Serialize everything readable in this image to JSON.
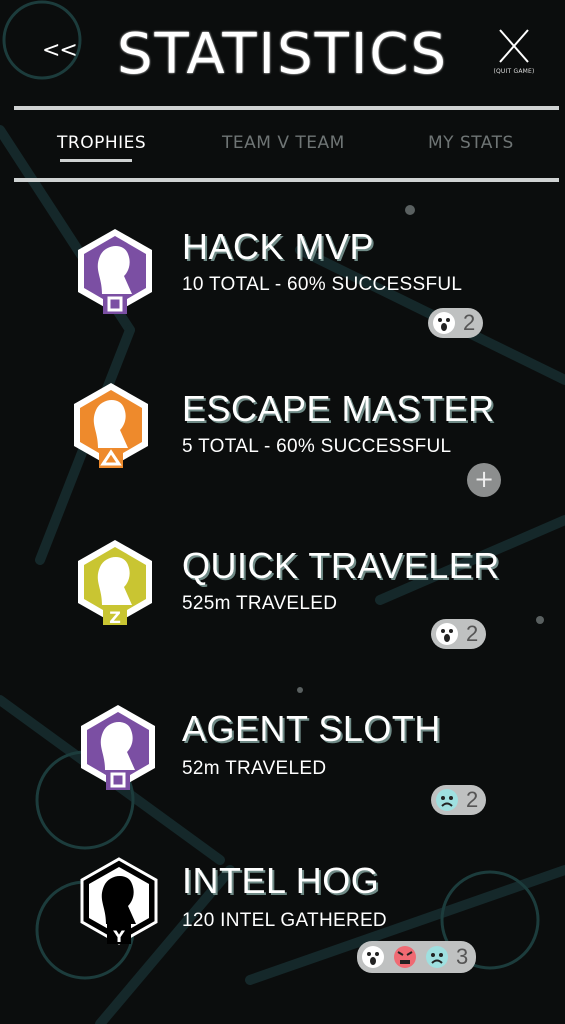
{
  "header": {
    "back_label": "<<",
    "title": "STATISTICS",
    "quit_label": "(QUIT GAME)"
  },
  "tabs": [
    {
      "label": "TROPHIES",
      "active": true
    },
    {
      "label": "TEAM V TEAM",
      "active": false
    },
    {
      "label": "MY STATS",
      "active": false
    }
  ],
  "trophies": [
    {
      "name": "HACK MVP",
      "desc": "10 TOTAL - 60% SUCCESSFUL",
      "badge_color": "#7b4fa3",
      "badge_symbol": "square",
      "reactions": {
        "emojis": [
          "surprised-face"
        ],
        "count": "2"
      }
    },
    {
      "name": "ESCAPE MASTER",
      "desc": "5 TOTAL - 60% SUCCESSFUL",
      "badge_color": "#ee8a2c",
      "badge_symbol": "triangle",
      "add_reaction": "+"
    },
    {
      "name": "QUICK TRAVELER",
      "desc": "525m TRAVELED",
      "badge_color": "#c9c532",
      "badge_symbol": "Z",
      "reactions": {
        "emojis": [
          "surprised-face"
        ],
        "count": "2"
      }
    },
    {
      "name": "AGENT SLOTH",
      "desc": "52m TRAVELED",
      "badge_color": "#7b4fa3",
      "badge_symbol": "square",
      "reactions": {
        "emojis": [
          "sad-face"
        ],
        "count": "2"
      }
    },
    {
      "name": "INTEL HOG",
      "desc": "120 INTEL GATHERED",
      "badge_color": "#ffffff",
      "badge_symbol": "Y",
      "reactions": {
        "emojis": [
          "surprised-face",
          "angry-face",
          "sad-face"
        ],
        "count": "3"
      }
    }
  ],
  "colors": {
    "background": "#0b0d0d",
    "divider": "#cfd2d2",
    "inactive_tab": "#6f7575",
    "pill": "#bfc1c1"
  }
}
